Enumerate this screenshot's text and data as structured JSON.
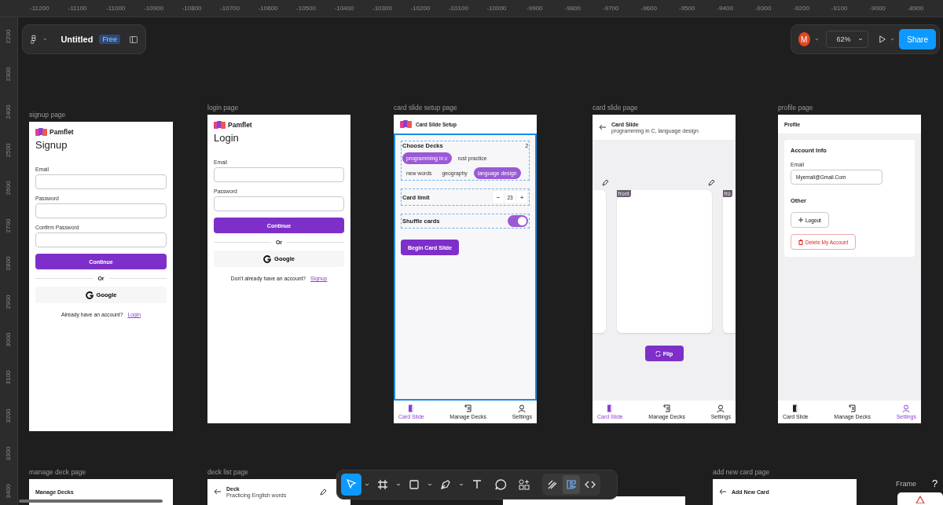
{
  "ruler": {
    "x_labels": [
      "-11200",
      "-11100",
      "-11000",
      "-10900",
      "-10800",
      "-10700",
      "-10600",
      "-10500",
      "-10400",
      "-10300",
      "-10200",
      "-10100",
      "-10000",
      "-9900",
      "-9800",
      "-9700",
      "-9600",
      "-9500",
      "-9400",
      "-9300",
      "-9200",
      "-9100",
      "-9000",
      "-8900"
    ],
    "y_labels": [
      "2200",
      "2300",
      "2400",
      "2500",
      "2600",
      "2700",
      "2800",
      "2900",
      "3000",
      "3100",
      "3200",
      "3300",
      "3400"
    ]
  },
  "file": {
    "name": "Untitled",
    "plan": "Free"
  },
  "session": {
    "avatar": "M",
    "zoom": "62%",
    "share": "Share"
  },
  "frames": [
    {
      "kind": "auth",
      "label": "signup page",
      "brand": "Pamflet",
      "title": "Signup",
      "fields": [
        {
          "label": "Email"
        },
        {
          "label": "Password"
        },
        {
          "label": "Confirm Password"
        }
      ],
      "submit": "Continue",
      "divider": "Or",
      "google": "Google",
      "footer": {
        "text": "Already have an account?",
        "link": "Login"
      }
    },
    {
      "kind": "auth",
      "label": "login page",
      "brand": "Pamflet",
      "title": "Login",
      "fields": [
        {
          "label": "Email"
        },
        {
          "label": "Password"
        }
      ],
      "submit": "Continue",
      "divider": "Or",
      "google": "Google",
      "footer": {
        "text": "Don't already have an account?",
        "link": "Signup"
      }
    },
    {
      "kind": "setup",
      "label": "card slide setup page",
      "header": "Card Slide Setup",
      "content_selected": true,
      "decks_title": "Choose Decks",
      "decks_count": "2",
      "chips": [
        {
          "label": "programming in c",
          "selected": true
        },
        {
          "label": "rust practice",
          "selected": false
        },
        {
          "label": "new words",
          "selected": false
        },
        {
          "label": "geography",
          "selected": false
        },
        {
          "label": "language design",
          "selected": true
        }
      ],
      "limit": {
        "label": "Card limit",
        "minus": "−",
        "value": "23",
        "plus": "+"
      },
      "shuffle": {
        "label": "Shuffle cards",
        "on": true
      },
      "begin": "Begin Card Slide",
      "nav": [
        {
          "label": "Card Slide",
          "selected": true
        },
        {
          "label": "Manage Decks",
          "selected": false
        },
        {
          "label": "Settings",
          "selected": false
        }
      ]
    },
    {
      "kind": "slide",
      "label": "card slide page",
      "title": "Card Slide",
      "subtitle": "programming in C, language design",
      "cards": [
        {
          "editable": true
        },
        {
          "tag": "front",
          "editable": true
        },
        {
          "tag": "fro",
          "editable": false
        }
      ],
      "flip": "Flip",
      "nav": [
        {
          "label": "Card Slide",
          "selected": true
        },
        {
          "label": "Manage Decks",
          "selected": false
        },
        {
          "label": "Settings",
          "selected": false
        }
      ]
    },
    {
      "kind": "profile",
      "label": "profile page",
      "header": "Profile",
      "section": "Account Info",
      "email_label": "Email",
      "email": "Myemail@Gmail.Com",
      "other": "Other",
      "logout": "Logout",
      "delete": "Delete My Account",
      "nav": [
        {
          "label": "Card Slide",
          "selected": false
        },
        {
          "label": "Manage Decks",
          "selected": false
        },
        {
          "label": "Settings",
          "selected": true
        }
      ]
    },
    {
      "kind": "stub",
      "label": "manage deck page",
      "title": "Manage Decks"
    },
    {
      "kind": "stub",
      "label": "deck list page",
      "title": "Deck",
      "subtitle": "Practicing English words",
      "back": true,
      "editable": true
    },
    {
      "kind": "blank"
    },
    {
      "kind": "stub",
      "label": "add new card page",
      "title": "Add New Card",
      "back": true
    }
  ],
  "tools": [
    {
      "kind": "move",
      "menu": true,
      "selected": true
    },
    {
      "kind": "frame",
      "menu": true,
      "selected": false
    },
    {
      "kind": "shape",
      "menu": true,
      "selected": false
    },
    {
      "kind": "pen",
      "menu": true,
      "selected": false
    },
    {
      "kind": "text",
      "selected": false
    },
    {
      "kind": "comment",
      "selected": false
    },
    {
      "kind": "actions",
      "selected": false
    }
  ],
  "modes": [
    {
      "kind": "draw",
      "selected": false
    },
    {
      "kind": "design",
      "selected": true
    },
    {
      "kind": "dev",
      "selected": false
    }
  ],
  "corner": {
    "label": "Frame",
    "help": "?"
  }
}
